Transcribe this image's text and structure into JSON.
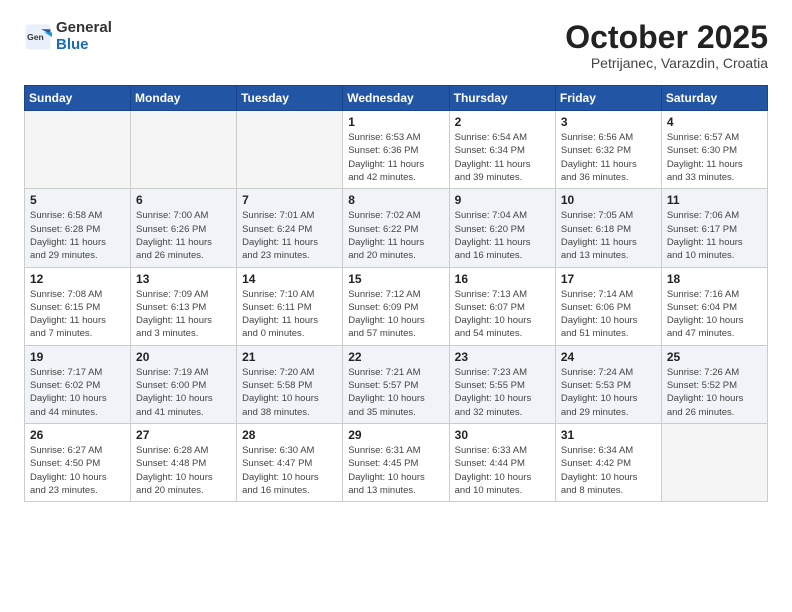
{
  "header": {
    "logo_general": "General",
    "logo_blue": "Blue",
    "month_title": "October 2025",
    "subtitle": "Petrijanec, Varazdin, Croatia"
  },
  "weekdays": [
    "Sunday",
    "Monday",
    "Tuesday",
    "Wednesday",
    "Thursday",
    "Friday",
    "Saturday"
  ],
  "weeks": [
    [
      {
        "day": "",
        "info": ""
      },
      {
        "day": "",
        "info": ""
      },
      {
        "day": "",
        "info": ""
      },
      {
        "day": "1",
        "info": "Sunrise: 6:53 AM\nSunset: 6:36 PM\nDaylight: 11 hours\nand 42 minutes."
      },
      {
        "day": "2",
        "info": "Sunrise: 6:54 AM\nSunset: 6:34 PM\nDaylight: 11 hours\nand 39 minutes."
      },
      {
        "day": "3",
        "info": "Sunrise: 6:56 AM\nSunset: 6:32 PM\nDaylight: 11 hours\nand 36 minutes."
      },
      {
        "day": "4",
        "info": "Sunrise: 6:57 AM\nSunset: 6:30 PM\nDaylight: 11 hours\nand 33 minutes."
      }
    ],
    [
      {
        "day": "5",
        "info": "Sunrise: 6:58 AM\nSunset: 6:28 PM\nDaylight: 11 hours\nand 29 minutes."
      },
      {
        "day": "6",
        "info": "Sunrise: 7:00 AM\nSunset: 6:26 PM\nDaylight: 11 hours\nand 26 minutes."
      },
      {
        "day": "7",
        "info": "Sunrise: 7:01 AM\nSunset: 6:24 PM\nDaylight: 11 hours\nand 23 minutes."
      },
      {
        "day": "8",
        "info": "Sunrise: 7:02 AM\nSunset: 6:22 PM\nDaylight: 11 hours\nand 20 minutes."
      },
      {
        "day": "9",
        "info": "Sunrise: 7:04 AM\nSunset: 6:20 PM\nDaylight: 11 hours\nand 16 minutes."
      },
      {
        "day": "10",
        "info": "Sunrise: 7:05 AM\nSunset: 6:18 PM\nDaylight: 11 hours\nand 13 minutes."
      },
      {
        "day": "11",
        "info": "Sunrise: 7:06 AM\nSunset: 6:17 PM\nDaylight: 11 hours\nand 10 minutes."
      }
    ],
    [
      {
        "day": "12",
        "info": "Sunrise: 7:08 AM\nSunset: 6:15 PM\nDaylight: 11 hours\nand 7 minutes."
      },
      {
        "day": "13",
        "info": "Sunrise: 7:09 AM\nSunset: 6:13 PM\nDaylight: 11 hours\nand 3 minutes."
      },
      {
        "day": "14",
        "info": "Sunrise: 7:10 AM\nSunset: 6:11 PM\nDaylight: 11 hours\nand 0 minutes."
      },
      {
        "day": "15",
        "info": "Sunrise: 7:12 AM\nSunset: 6:09 PM\nDaylight: 10 hours\nand 57 minutes."
      },
      {
        "day": "16",
        "info": "Sunrise: 7:13 AM\nSunset: 6:07 PM\nDaylight: 10 hours\nand 54 minutes."
      },
      {
        "day": "17",
        "info": "Sunrise: 7:14 AM\nSunset: 6:06 PM\nDaylight: 10 hours\nand 51 minutes."
      },
      {
        "day": "18",
        "info": "Sunrise: 7:16 AM\nSunset: 6:04 PM\nDaylight: 10 hours\nand 47 minutes."
      }
    ],
    [
      {
        "day": "19",
        "info": "Sunrise: 7:17 AM\nSunset: 6:02 PM\nDaylight: 10 hours\nand 44 minutes."
      },
      {
        "day": "20",
        "info": "Sunrise: 7:19 AM\nSunset: 6:00 PM\nDaylight: 10 hours\nand 41 minutes."
      },
      {
        "day": "21",
        "info": "Sunrise: 7:20 AM\nSunset: 5:58 PM\nDaylight: 10 hours\nand 38 minutes."
      },
      {
        "day": "22",
        "info": "Sunrise: 7:21 AM\nSunset: 5:57 PM\nDaylight: 10 hours\nand 35 minutes."
      },
      {
        "day": "23",
        "info": "Sunrise: 7:23 AM\nSunset: 5:55 PM\nDaylight: 10 hours\nand 32 minutes."
      },
      {
        "day": "24",
        "info": "Sunrise: 7:24 AM\nSunset: 5:53 PM\nDaylight: 10 hours\nand 29 minutes."
      },
      {
        "day": "25",
        "info": "Sunrise: 7:26 AM\nSunset: 5:52 PM\nDaylight: 10 hours\nand 26 minutes."
      }
    ],
    [
      {
        "day": "26",
        "info": "Sunrise: 6:27 AM\nSunset: 4:50 PM\nDaylight: 10 hours\nand 23 minutes."
      },
      {
        "day": "27",
        "info": "Sunrise: 6:28 AM\nSunset: 4:48 PM\nDaylight: 10 hours\nand 20 minutes."
      },
      {
        "day": "28",
        "info": "Sunrise: 6:30 AM\nSunset: 4:47 PM\nDaylight: 10 hours\nand 16 minutes."
      },
      {
        "day": "29",
        "info": "Sunrise: 6:31 AM\nSunset: 4:45 PM\nDaylight: 10 hours\nand 13 minutes."
      },
      {
        "day": "30",
        "info": "Sunrise: 6:33 AM\nSunset: 4:44 PM\nDaylight: 10 hours\nand 10 minutes."
      },
      {
        "day": "31",
        "info": "Sunrise: 6:34 AM\nSunset: 4:42 PM\nDaylight: 10 hours\nand 8 minutes."
      },
      {
        "day": "",
        "info": ""
      }
    ]
  ]
}
